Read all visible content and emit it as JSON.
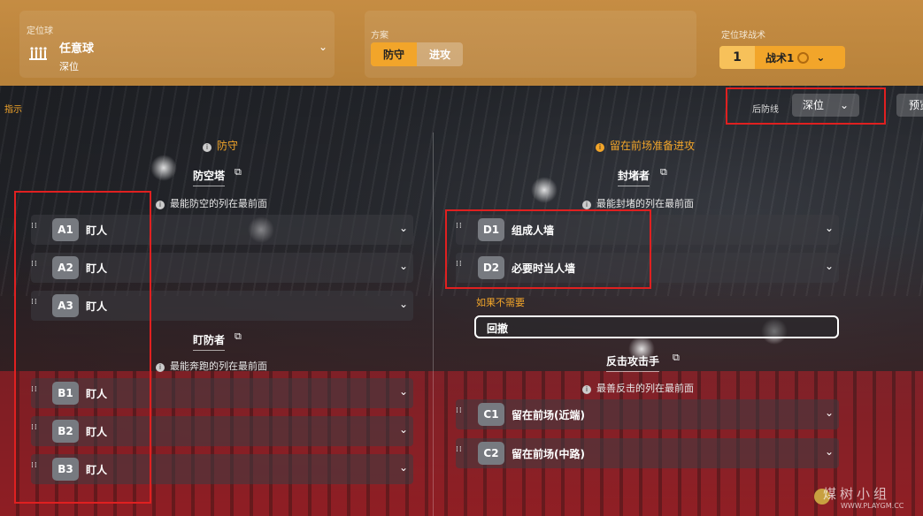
{
  "header": {
    "setpiece_label": "定位球",
    "setpiece_name": "任意球",
    "setpiece_sub": "深位",
    "plan_label": "方案",
    "plan_options": [
      "防守",
      "进攻"
    ],
    "tactic_label": "定位球战术",
    "tactic_number": "1",
    "tactic_name": "战术1"
  },
  "toolbar": {
    "hint": "指示",
    "backline_label": "后防线",
    "backline_value": "深位",
    "preview": "预览"
  },
  "defense": {
    "title": "防守",
    "aerial": {
      "head": "防空塔",
      "note": "最能防空的列在最前面",
      "rows": [
        {
          "badge": "A1",
          "label": "盯人"
        },
        {
          "badge": "A2",
          "label": "盯人"
        },
        {
          "badge": "A3",
          "label": "盯人"
        }
      ]
    },
    "marking": {
      "head": "盯防者",
      "note": "最能奔跑的列在最前面",
      "rows": [
        {
          "badge": "B1",
          "label": "盯人"
        },
        {
          "badge": "B2",
          "label": "盯人"
        },
        {
          "badge": "B3",
          "label": "盯人"
        }
      ]
    }
  },
  "attack": {
    "title": "留在前场准备进攻",
    "blocker": {
      "head": "封堵者",
      "note": "最能封堵的列在最前面",
      "rows": [
        {
          "badge": "D1",
          "label": "组成人墙"
        },
        {
          "badge": "D2",
          "label": "必要时当人墙"
        }
      ]
    },
    "if_not_needed": "如果不需要",
    "fallback": "回撤",
    "counter": {
      "head": "反击攻击手",
      "note": "最善反击的列在最前面",
      "rows": [
        {
          "badge": "C1",
          "label": "留在前场(近端)"
        },
        {
          "badge": "C2",
          "label": "留在前场(中路)"
        }
      ]
    }
  },
  "watermark": {
    "title": "煤树小组",
    "url": "WWW.PLAYGM.CC"
  }
}
